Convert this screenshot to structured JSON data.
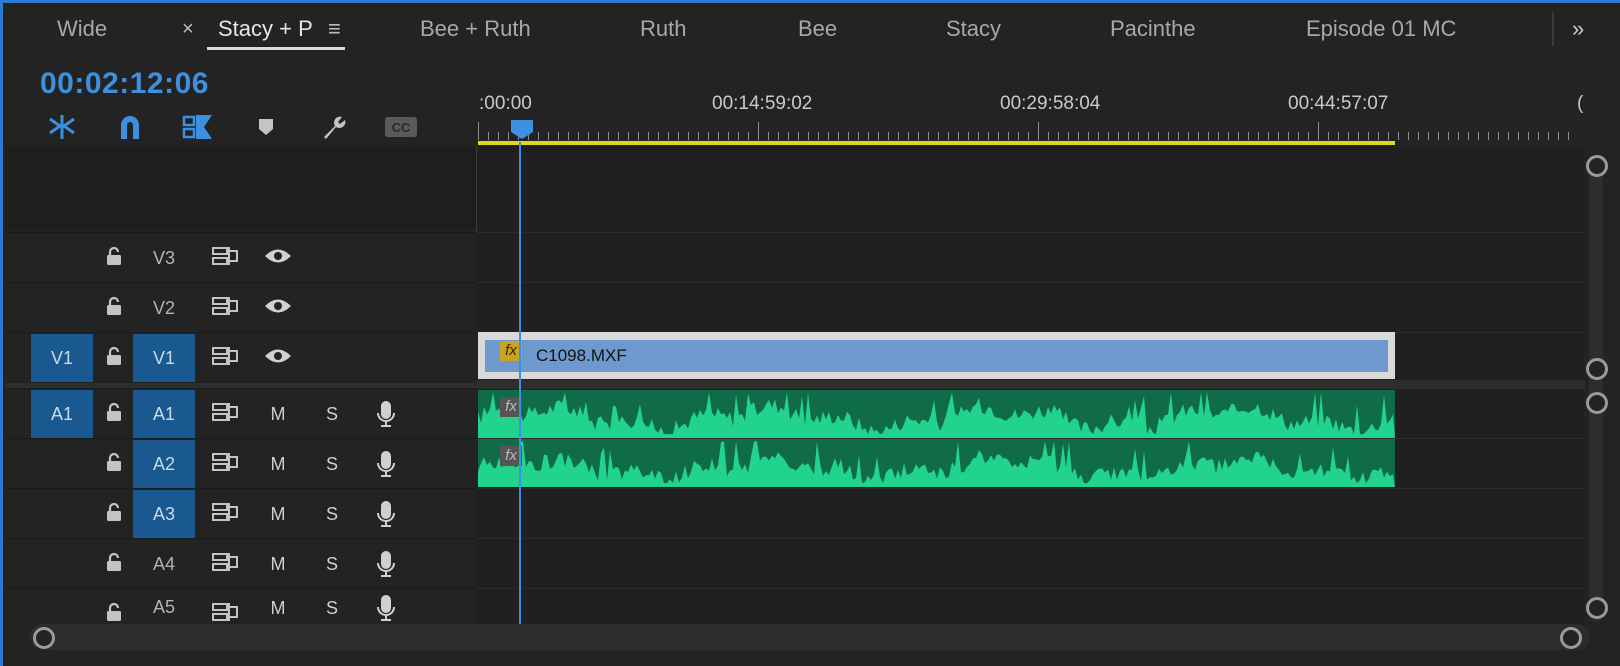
{
  "tabs": [
    {
      "label": "Wide",
      "active": false
    },
    {
      "label": "Stacy + P",
      "active": true
    },
    {
      "label": "Bee + Ruth",
      "active": false
    },
    {
      "label": "Ruth",
      "active": false
    },
    {
      "label": "Bee",
      "active": false
    },
    {
      "label": "Stacy",
      "active": false
    },
    {
      "label": "Pacinthe",
      "active": false
    },
    {
      "label": "Episode 01 MC",
      "active": false
    }
  ],
  "tab_close_glyph": "×",
  "tab_menu_glyph": "≡",
  "tab_overflow_glyph": "»",
  "timecode": "00:02:12:06",
  "toolbar": {
    "icons": [
      "insert-nest-icon",
      "snap-magnet-icon",
      "linked-selection-icon",
      "add-marker-icon",
      "timeline-settings-wrench-icon",
      "captions-cc-icon"
    ]
  },
  "ruler": {
    "labels": [
      ":00:00",
      "00:14:59:02",
      "00:29:58:04",
      "00:44:57:07",
      "("
    ]
  },
  "playhead_fraction": 0.045,
  "video_tracks": [
    {
      "label": "V3",
      "target": "",
      "label_targeted": false
    },
    {
      "label": "V2",
      "target": "",
      "label_targeted": false
    },
    {
      "label": "V1",
      "target": "V1",
      "label_targeted": true
    }
  ],
  "audio_tracks": [
    {
      "label": "A1",
      "target": "A1",
      "label_targeted": true,
      "mute": "M",
      "solo": "S"
    },
    {
      "label": "A2",
      "target": "",
      "label_targeted": true,
      "mute": "M",
      "solo": "S"
    },
    {
      "label": "A3",
      "target": "",
      "label_targeted": true,
      "mute": "M",
      "solo": "S"
    },
    {
      "label": "A4",
      "target": "",
      "label_targeted": false,
      "mute": "M",
      "solo": "S"
    },
    {
      "label": "A5",
      "target": "",
      "label_targeted": false,
      "mute": "M",
      "solo": "S"
    }
  ],
  "video_clip": {
    "name": "C1098.MXF",
    "fx": "fx"
  },
  "audio_clips": [
    {
      "fx": "fx"
    },
    {
      "fx": "fx"
    }
  ],
  "colors": {
    "accent": "#3d8fe0",
    "target_fill": "#19598f",
    "video_clip": "#6e99cf",
    "audio_clip_bg": "#0f6b48",
    "audio_waveform": "#22d38e",
    "work_area": "#e5d321"
  }
}
